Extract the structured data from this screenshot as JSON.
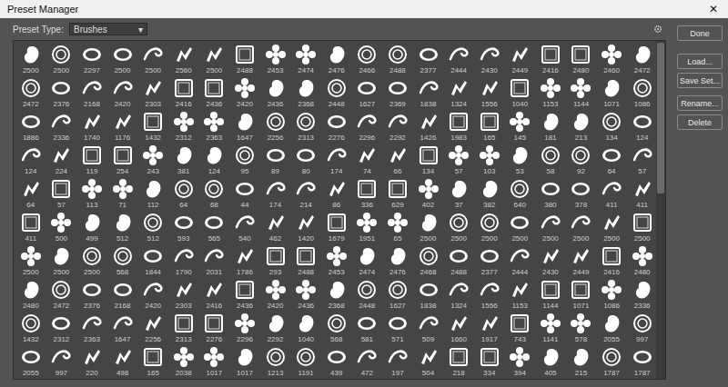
{
  "window": {
    "title": "Preset Manager",
    "close": "✕"
  },
  "preset_type": {
    "label": "Preset Type:",
    "value": "Brushes",
    "arrow": "▾"
  },
  "buttons": [
    "Done",
    "Load...",
    "Save Set...",
    "Rename...",
    "Delete"
  ],
  "scrollbar": {
    "level": 0.45
  },
  "brushes": [
    [
      "2500",
      "2500",
      "2297",
      "2500",
      "2500",
      "2560",
      "2500",
      "2488",
      "2453",
      "2474",
      "2476",
      "2466",
      "2488",
      "2377",
      "2444",
      "2430",
      "2449",
      "2416",
      "2480",
      "2460",
      "2472"
    ],
    [
      "2472",
      "2376",
      "2168",
      "2420",
      "2303",
      "2416",
      "2436",
      "2420",
      "2436",
      "2368",
      "2448",
      "1627",
      "2369",
      "1838",
      "1324",
      "1556",
      "1040",
      "1153",
      "1144",
      "1071",
      "1086"
    ],
    [
      "1886",
      "2336",
      "1740",
      "1176",
      "1432",
      "2312",
      "2363",
      "1647",
      "2256",
      "2313",
      "2276",
      "2296",
      "2292",
      "1426",
      "1983",
      "165",
      "145",
      "181",
      "213",
      "134",
      "124"
    ],
    [
      "124",
      "224",
      "119",
      "254",
      "243",
      "381",
      "124",
      "95",
      "89",
      "80",
      "174",
      "74",
      "66",
      "134",
      "57",
      "103",
      "53",
      "58",
      "92",
      "64",
      "57"
    ],
    [
      "64",
      "57",
      "113",
      "71",
      "112",
      "64",
      "68",
      "44",
      "174",
      "214",
      "86",
      "336",
      "629",
      "402",
      "37",
      "382",
      "640",
      "380",
      "378",
      "411",
      "411"
    ],
    [
      "411",
      "500",
      "499",
      "512",
      "512",
      "593",
      "565",
      "540",
      "462",
      "1420",
      "1679",
      "1951",
      "65",
      "2500",
      "2500",
      "2500",
      "2500",
      "2500",
      "2500",
      "2500",
      "2500"
    ],
    [
      "2500",
      "2500",
      "2500",
      "568",
      "1844",
      "1790",
      "2031",
      "1786",
      "293",
      "2488",
      "2453",
      "2474",
      "2476",
      "2468",
      "2488",
      "2377",
      "2444",
      "2430",
      "2449",
      "2416",
      "2480"
    ],
    [
      "2480",
      "2472",
      "2376",
      "2168",
      "2420",
      "2303",
      "2416",
      "2436",
      "2420",
      "2436",
      "2368",
      "2448",
      "1627",
      "1838",
      "1324",
      "1556",
      "1153",
      "1144",
      "1071",
      "1086",
      "2336"
    ],
    [
      "1432",
      "2312",
      "2363",
      "1647",
      "2256",
      "2313",
      "2276",
      "2296",
      "2292",
      "1040",
      "568",
      "581",
      "571",
      "509",
      "1660",
      "1917",
      "743",
      "1141",
      "578",
      "2055",
      "997"
    ],
    [
      "2055",
      "997",
      "220",
      "498",
      "165",
      "2038",
      "1017",
      "1017",
      "1213",
      "1191",
      "439",
      "472",
      "197",
      "504",
      "218",
      "334",
      "394",
      "405",
      "215",
      "1787",
      "1787"
    ]
  ]
}
